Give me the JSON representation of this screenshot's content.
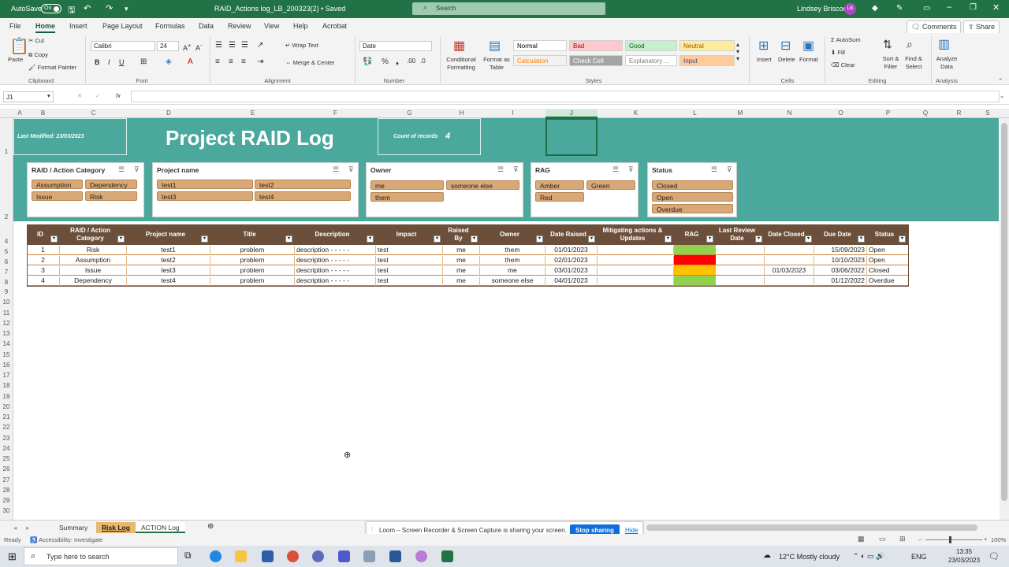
{
  "titlebar": {
    "autosave_label": "AutoSave",
    "autosave_state": "On",
    "file_title": "RAID_Actions log_LB_200323(2) • Saved",
    "search_placeholder": "Search",
    "user_name": "Lindsey Briscoe",
    "user_initials": "LB"
  },
  "ribbon_tabs": [
    "File",
    "Home",
    "Insert",
    "Page Layout",
    "Formulas",
    "Data",
    "Review",
    "View",
    "Help",
    "Acrobat"
  ],
  "ribbon_right": {
    "comments": "Comments",
    "share": "Share"
  },
  "ribbon": {
    "clipboard": {
      "paste": "Paste",
      "cut": "Cut",
      "copy": "Copy",
      "format_painter": "Format Painter",
      "group": "Clipboard"
    },
    "font": {
      "name": "Calibri",
      "size": "24",
      "group": "Font"
    },
    "alignment": {
      "wrap": "Wrap Text",
      "merge": "Merge & Center",
      "group": "Alignment"
    },
    "number": {
      "format": "Date",
      "group": "Number"
    },
    "styles": {
      "conditional": "Conditional Formatting",
      "format_table": "Format as Table",
      "group": "Styles",
      "cells": [
        {
          "label": "Normal",
          "bg": "#ffffff",
          "fg": "#000000"
        },
        {
          "label": "Bad",
          "bg": "#ffc7ce",
          "fg": "#9c0006"
        },
        {
          "label": "Good",
          "bg": "#c6efce",
          "fg": "#006100"
        },
        {
          "label": "Neutral",
          "bg": "#ffeb9c",
          "fg": "#9c5700"
        },
        {
          "label": "Calculation",
          "bg": "#f2f2f2",
          "fg": "#fa7d00"
        },
        {
          "label": "Check Cell",
          "bg": "#a5a5a5",
          "fg": "#ffffff"
        },
        {
          "label": "Explanatory ...",
          "bg": "#ffffff",
          "fg": "#7f7f7f"
        },
        {
          "label": "Input",
          "bg": "#ffcc99",
          "fg": "#3f3f76"
        }
      ]
    },
    "cells": {
      "insert": "Insert",
      "delete": "Delete",
      "format": "Format",
      "group": "Cells"
    },
    "editing": {
      "autosum": "AutoSum",
      "fill": "Fill",
      "clear": "Clear",
      "sort": "Sort & Filter",
      "find": "Find & Select",
      "group": "Editing"
    },
    "analysis": {
      "analyze": "Analyze Data",
      "group": "Analysis"
    }
  },
  "formula_bar": {
    "name_box": "J1",
    "fx": "fx"
  },
  "columns": [
    "A",
    "B",
    "C",
    "D",
    "E",
    "F",
    "G",
    "H",
    "I",
    "J",
    "K",
    "L",
    "M",
    "N",
    "O",
    "P",
    "Q",
    "R",
    "S",
    "T"
  ],
  "rows": [
    "1",
    "2",
    "4",
    "5",
    "6",
    "7",
    "8",
    "9",
    "10",
    "11",
    "12",
    "13",
    "14",
    "15",
    "16",
    "17",
    "18",
    "19",
    "20",
    "21",
    "22",
    "23",
    "24",
    "25",
    "26",
    "27",
    "28",
    "29",
    "30"
  ],
  "banner": {
    "last_modified": "Last Modified:  23/03/2023",
    "title": "Project RAID Log",
    "count_label": "Count of records",
    "count_value": "4"
  },
  "slicers": [
    {
      "title": "RAID / Action Category",
      "items": [
        "Assumption",
        "Dependency",
        "Issue",
        "Risk"
      ]
    },
    {
      "title": "Project name",
      "items": [
        "test1",
        "test2",
        "test3",
        "test4"
      ]
    },
    {
      "title": "Owner",
      "items": [
        "me",
        "someone else",
        "them"
      ]
    },
    {
      "title": "RAG",
      "items": [
        "Amber",
        "Green",
        "Red"
      ]
    },
    {
      "title": "Status",
      "items": [
        "Closed",
        "Open",
        "Overdue"
      ]
    }
  ],
  "table": {
    "headers": [
      "ID",
      "RAID / Action Category",
      "Project name",
      "Title",
      "Description",
      "Impact",
      "Raised By",
      "Owner",
      "Date Raised",
      "Mitigating actions & Updates",
      "RAG",
      "Last Review Date",
      "Date Closed",
      "Due Date",
      "Status"
    ],
    "rows": [
      {
        "id": "1",
        "category": "Risk",
        "project": "test1",
        "title": "problem",
        "description": "description - - - - -",
        "impact": "test",
        "raised_by": "me",
        "owner": "them",
        "date_raised": "01/01/2023",
        "mitigating": "",
        "rag": "#92d050",
        "last_review": "",
        "date_closed": "",
        "due_date": "15/09/2023",
        "status": "Open"
      },
      {
        "id": "2",
        "category": "Assumption",
        "project": "test2",
        "title": "problem",
        "description": "description - - - - -",
        "impact": "test",
        "raised_by": "me",
        "owner": "them",
        "date_raised": "02/01/2023",
        "mitigating": "",
        "rag": "#ff0000",
        "last_review": "",
        "date_closed": "",
        "due_date": "10/10/2023",
        "status": "Open"
      },
      {
        "id": "3",
        "category": "Issue",
        "project": "test3",
        "title": "problem",
        "description": "description - - - - -",
        "impact": "test",
        "raised_by": "me",
        "owner": "me",
        "date_raised": "03/01/2023",
        "mitigating": "",
        "rag": "#ffc000",
        "last_review": "",
        "date_closed": "01/03/2023",
        "due_date": "03/06/2022",
        "status": "Closed"
      },
      {
        "id": "4",
        "category": "Dependency",
        "project": "test4",
        "title": "problem",
        "description": "description - - - - -",
        "impact": "test",
        "raised_by": "me",
        "owner": "someone else",
        "date_raised": "04/01/2023",
        "mitigating": "",
        "rag": "#92d050",
        "last_review": "",
        "date_closed": "",
        "due_date": "01/12/2022",
        "status": "Overdue"
      }
    ]
  },
  "sheet_tabs": [
    "Summary",
    "Risk Log",
    "ACTION Log"
  ],
  "loom": {
    "message": "Loom – Screen Recorder & Screen Capture is sharing your screen.",
    "stop": "Stop sharing",
    "hide": "Hide"
  },
  "status_bar": {
    "ready": "Ready",
    "accessibility": "Accessibility: Investigate",
    "zoom": "100%"
  },
  "taskbar": {
    "search_placeholder": "Type here to search",
    "weather": "12°C  Mostly cloudy",
    "lang": "ENG",
    "time": "13:35",
    "date": "23/03/2023"
  }
}
